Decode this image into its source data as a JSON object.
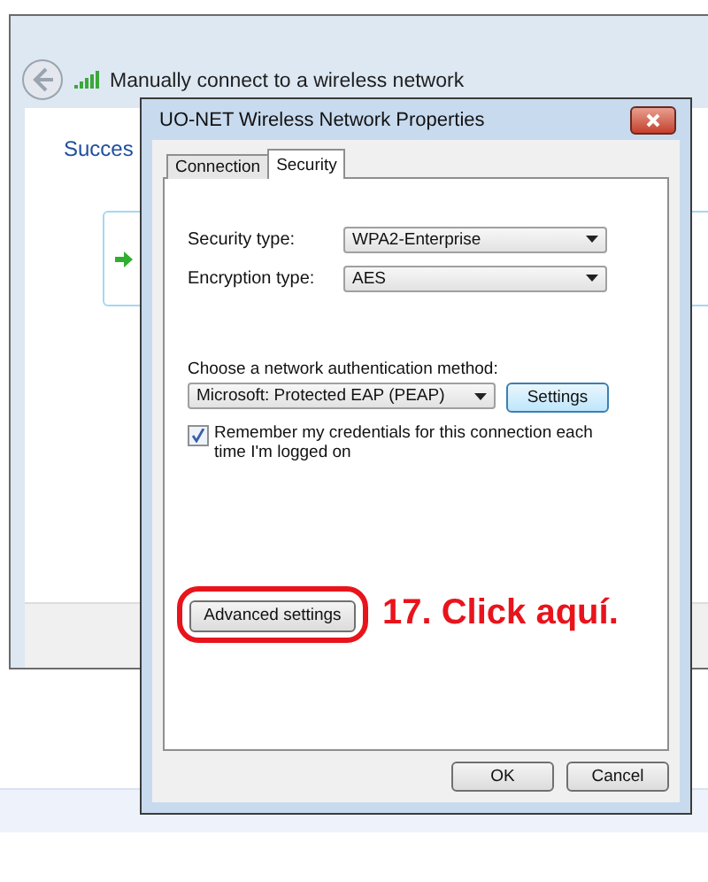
{
  "background_window": {
    "title": "Manually connect to a wireless network",
    "heading": "Succes"
  },
  "dialog": {
    "title": "UO-NET Wireless Network Properties",
    "tabs": [
      {
        "label": "Connection",
        "selected": false
      },
      {
        "label": "Security",
        "selected": true
      }
    ],
    "fields": [
      {
        "label": "Security type:",
        "value": "WPA2-Enterprise"
      },
      {
        "label": "Encryption type:",
        "value": "AES"
      }
    ],
    "auth": {
      "label": "Choose a network authentication method:",
      "value": "Microsoft: Protected EAP (PEAP)",
      "button": "Settings"
    },
    "remember": {
      "label": "Remember my credentials for this connection each time I'm logged on",
      "checked": true
    },
    "advanced_button": "Advanced settings",
    "buttons": [
      "OK",
      "Cancel"
    ]
  },
  "annotation": {
    "text": "17. Click aquí."
  }
}
